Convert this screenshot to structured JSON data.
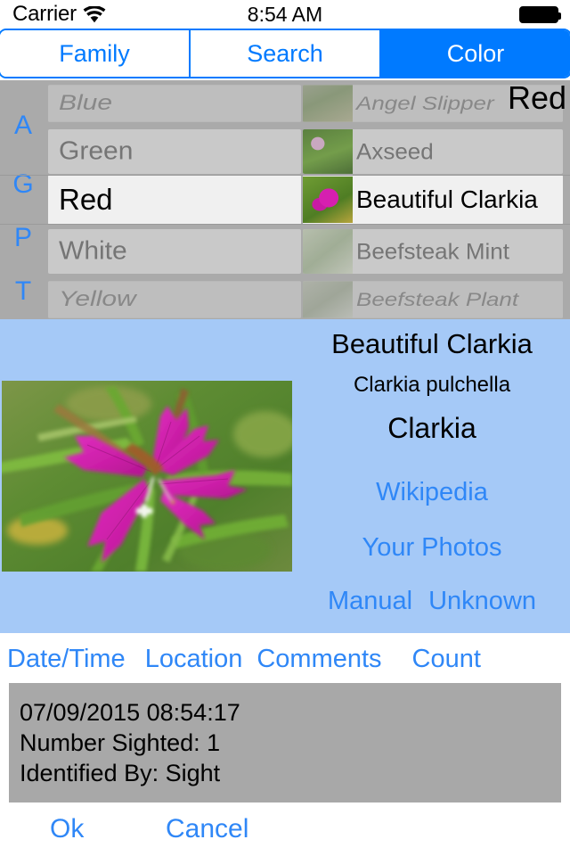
{
  "status_bar": {
    "carrier": "Carrier",
    "wifi_icon": "wifi-icon",
    "time": "8:54 AM",
    "battery_icon": "battery-full-icon"
  },
  "segmented_control": {
    "segments": [
      {
        "label": "Family",
        "active": false
      },
      {
        "label": "Search",
        "active": false
      },
      {
        "label": "Color",
        "active": true
      }
    ],
    "accent_color": "#007aff"
  },
  "picker": {
    "overlay_label": "Red",
    "index_letters": [
      "A",
      "G",
      "P",
      "T"
    ],
    "color_column": {
      "rows": [
        "Blue",
        "Green",
        "Red",
        "White",
        "Yellow"
      ],
      "selected": "Red",
      "selected_index": 2
    },
    "name_column": {
      "rows": [
        "Angel Slipper",
        "Axseed",
        "Beautiful Clarkia",
        "Beefsteak Mint",
        "Beefsteak Plant"
      ],
      "selected": "Beautiful Clarkia",
      "selected_index": 2
    }
  },
  "detail": {
    "common_name": "Beautiful Clarkia",
    "latin_name": "Clarkia pulchella",
    "genus": "Clarkia",
    "wikipedia_label": "Wikipedia",
    "your_photos_label": "Your Photos",
    "manual_label": "Manual",
    "unknown_label": "Unknown",
    "background_color": "#a5c9f7",
    "photo_alt": "flower-photo"
  },
  "tabs": [
    {
      "label": "Date/Time"
    },
    {
      "label": "Location"
    },
    {
      "label": "Comments"
    },
    {
      "label": "Count"
    }
  ],
  "data_box": {
    "lines": [
      "07/09/2015 08:54:17",
      "Number Sighted: 1",
      "Identified By: Sight"
    ],
    "background_color": "#a8a8a8"
  },
  "footer": {
    "ok_label": "Ok",
    "cancel_label": "Cancel"
  }
}
